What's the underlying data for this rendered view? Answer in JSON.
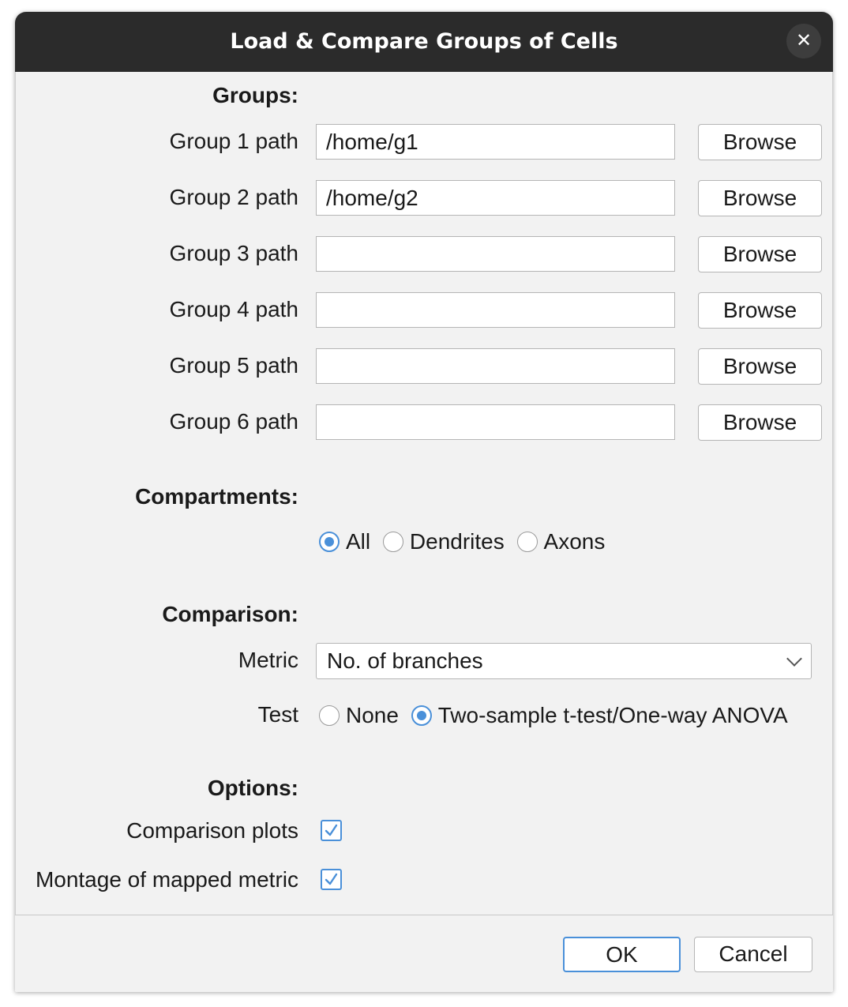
{
  "window": {
    "title": "Load & Compare Groups of Cells",
    "close_symbol": "✕"
  },
  "groups": {
    "header": "Groups:",
    "browse_label": "Browse",
    "rows": [
      {
        "label": "Group 1 path",
        "value": "/home/g1"
      },
      {
        "label": "Group 2 path",
        "value": "/home/g2"
      },
      {
        "label": "Group 3 path",
        "value": ""
      },
      {
        "label": "Group 4 path",
        "value": ""
      },
      {
        "label": "Group 5 path",
        "value": ""
      },
      {
        "label": "Group 6 path",
        "value": ""
      }
    ]
  },
  "compartments": {
    "header": "Compartments:",
    "options": [
      {
        "label": "All",
        "selected": true
      },
      {
        "label": "Dendrites",
        "selected": false
      },
      {
        "label": "Axons",
        "selected": false
      }
    ]
  },
  "comparison": {
    "header": "Comparison:",
    "metric_label": "Metric",
    "metric_value": "No. of branches",
    "test_label": "Test",
    "test_options": [
      {
        "label": "None",
        "selected": false
      },
      {
        "label": "Two-sample t-test/One-way ANOVA",
        "selected": true
      }
    ]
  },
  "options": {
    "header": "Options:",
    "items": [
      {
        "label": "Comparison plots",
        "checked": true
      },
      {
        "label": "Montage of mapped metric",
        "checked": true
      }
    ]
  },
  "footer": {
    "ok_label": "OK",
    "cancel_label": "Cancel"
  },
  "colors": {
    "accent": "#4a90d9",
    "titlebar": "#2b2b2b",
    "background": "#f2f2f2"
  }
}
